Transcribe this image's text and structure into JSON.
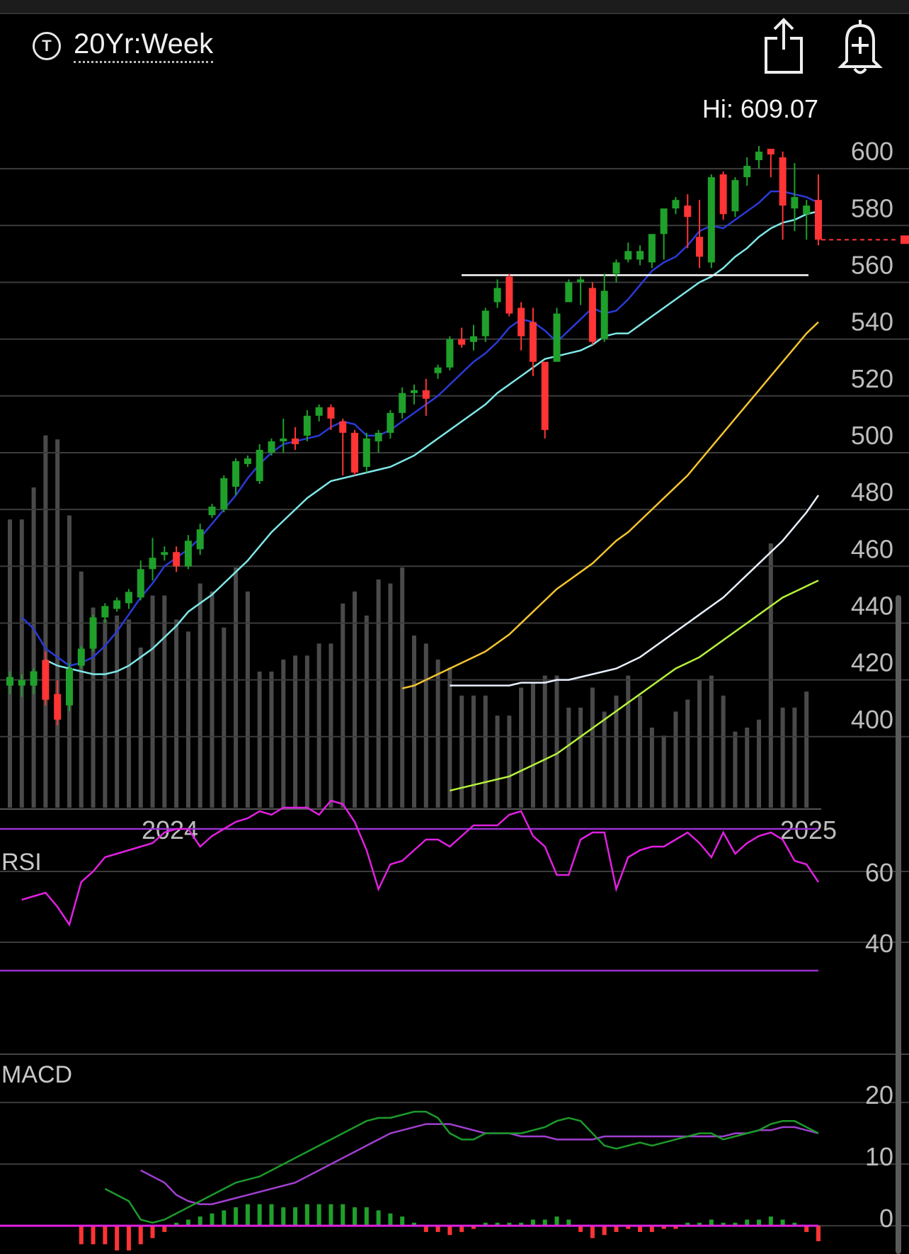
{
  "header": {
    "ticker_icon": "T",
    "range_label": "20Yr:Week",
    "hi_label": "Hi: 609.07",
    "share_icon": "share-icon",
    "alert_icon": "alert-add-icon"
  },
  "colors": {
    "up": "#1fa02a",
    "down": "#ff3434",
    "ema8": "#2a3ad8",
    "ema21": "#7fe8e8",
    "sma50": "#f4c430",
    "sma100": "#e8f0ff",
    "sma200": "#b6f23c",
    "rsi": "#e020e0",
    "rsi_band": "#9a30d0",
    "macd": "#1c9a2a",
    "signal": "#a040d0",
    "hist_zero": "#e020e0"
  },
  "chart_data": [
    {
      "type": "candlestick",
      "title": "20Yr:Week",
      "x_labels": [
        "2024",
        "2025"
      ],
      "y_ticks": [
        400,
        420,
        440,
        460,
        480,
        500,
        520,
        540,
        560,
        580,
        600
      ],
      "ylim": [
        377,
        612
      ],
      "high_value": 609.07,
      "last_price": 575,
      "resistance_level": 562.5,
      "grid": true,
      "candles": [
        {
          "o": 418,
          "h": 423,
          "l": 415,
          "c": 421
        },
        {
          "o": 418,
          "h": 422,
          "l": 414,
          "c": 420
        },
        {
          "o": 418,
          "h": 424,
          "l": 415,
          "c": 423
        },
        {
          "o": 427,
          "h": 430,
          "l": 411,
          "c": 413
        },
        {
          "o": 415,
          "h": 420,
          "l": 404,
          "c": 406
        },
        {
          "o": 411,
          "h": 426,
          "l": 409,
          "c": 424
        },
        {
          "o": 425,
          "h": 432,
          "l": 424,
          "c": 431
        },
        {
          "o": 431,
          "h": 443,
          "l": 430,
          "c": 442
        },
        {
          "o": 442,
          "h": 447,
          "l": 440,
          "c": 446
        },
        {
          "o": 445,
          "h": 449,
          "l": 444,
          "c": 448
        },
        {
          "o": 447,
          "h": 452,
          "l": 445,
          "c": 451
        },
        {
          "o": 449,
          "h": 462,
          "l": 448,
          "c": 459
        },
        {
          "o": 459,
          "h": 470,
          "l": 455,
          "c": 463
        },
        {
          "o": 464,
          "h": 467,
          "l": 462,
          "c": 465
        },
        {
          "o": 465,
          "h": 467,
          "l": 458,
          "c": 460
        },
        {
          "o": 460,
          "h": 471,
          "l": 459,
          "c": 469
        },
        {
          "o": 466,
          "h": 475,
          "l": 464,
          "c": 473
        },
        {
          "o": 478,
          "h": 482,
          "l": 477,
          "c": 481
        },
        {
          "o": 480,
          "h": 492,
          "l": 479,
          "c": 491
        },
        {
          "o": 488,
          "h": 498,
          "l": 485,
          "c": 497
        },
        {
          "o": 496,
          "h": 499,
          "l": 495,
          "c": 498
        },
        {
          "o": 490,
          "h": 503,
          "l": 489,
          "c": 501
        },
        {
          "o": 500,
          "h": 505,
          "l": 499,
          "c": 504
        },
        {
          "o": 504,
          "h": 512,
          "l": 500,
          "c": 505
        },
        {
          "o": 505,
          "h": 509,
          "l": 501,
          "c": 503
        },
        {
          "o": 506,
          "h": 515,
          "l": 504,
          "c": 513
        },
        {
          "o": 513,
          "h": 517,
          "l": 511,
          "c": 516
        },
        {
          "o": 516,
          "h": 517,
          "l": 508,
          "c": 512
        },
        {
          "o": 511,
          "h": 512,
          "l": 492,
          "c": 507
        },
        {
          "o": 507,
          "h": 508,
          "l": 492,
          "c": 493
        },
        {
          "o": 495,
          "h": 507,
          "l": 493,
          "c": 505
        },
        {
          "o": 504,
          "h": 508,
          "l": 500,
          "c": 507
        },
        {
          "o": 507,
          "h": 515,
          "l": 505,
          "c": 514
        },
        {
          "o": 514,
          "h": 523,
          "l": 512,
          "c": 521
        },
        {
          "o": 521,
          "h": 524,
          "l": 517,
          "c": 522
        },
        {
          "o": 522,
          "h": 526,
          "l": 513,
          "c": 519
        },
        {
          "o": 528,
          "h": 531,
          "l": 526,
          "c": 530
        },
        {
          "o": 530,
          "h": 541,
          "l": 529,
          "c": 540
        },
        {
          "o": 540,
          "h": 544,
          "l": 537,
          "c": 538
        },
        {
          "o": 539,
          "h": 545,
          "l": 536,
          "c": 541
        },
        {
          "o": 541,
          "h": 551,
          "l": 539,
          "c": 550
        },
        {
          "o": 553,
          "h": 561,
          "l": 551,
          "c": 558
        },
        {
          "o": 562,
          "h": 563,
          "l": 548,
          "c": 549
        },
        {
          "o": 551,
          "h": 553,
          "l": 536,
          "c": 541
        },
        {
          "o": 546,
          "h": 551,
          "l": 527,
          "c": 532
        },
        {
          "o": 532,
          "h": 531,
          "l": 505,
          "c": 508
        },
        {
          "o": 532,
          "h": 551,
          "l": 532,
          "c": 549
        },
        {
          "o": 553,
          "h": 561,
          "l": 553,
          "c": 560
        },
        {
          "o": 560,
          "h": 562,
          "l": 552,
          "c": 561
        },
        {
          "o": 558,
          "h": 560,
          "l": 538,
          "c": 539
        },
        {
          "o": 540,
          "h": 563,
          "l": 539,
          "c": 557
        },
        {
          "o": 563,
          "h": 568,
          "l": 560,
          "c": 567
        },
        {
          "o": 568,
          "h": 574,
          "l": 567,
          "c": 571
        },
        {
          "o": 568,
          "h": 573,
          "l": 566,
          "c": 571
        },
        {
          "o": 567,
          "h": 569,
          "l": 565,
          "c": 577
        },
        {
          "o": 577,
          "h": 578,
          "l": 568,
          "c": 586
        },
        {
          "o": 586,
          "h": 590,
          "l": 584,
          "c": 589
        },
        {
          "o": 587,
          "h": 591,
          "l": 572,
          "c": 583
        },
        {
          "o": 576,
          "h": 589,
          "l": 565,
          "c": 569
        },
        {
          "o": 567,
          "h": 598,
          "l": 565,
          "c": 597
        },
        {
          "o": 598,
          "h": 599,
          "l": 582,
          "c": 584
        },
        {
          "o": 585,
          "h": 597,
          "l": 583,
          "c": 596
        },
        {
          "o": 597,
          "h": 604,
          "l": 594,
          "c": 601
        },
        {
          "o": 603,
          "h": 608,
          "l": 600,
          "c": 606
        },
        {
          "o": 607,
          "h": 607,
          "l": 597,
          "c": 605
        },
        {
          "o": 604,
          "h": 606,
          "l": 575,
          "c": 587
        },
        {
          "o": 586,
          "h": 602,
          "l": 578,
          "c": 590
        },
        {
          "o": 584,
          "h": 589,
          "l": 575,
          "c": 587
        },
        {
          "o": 589,
          "h": 598,
          "l": 573,
          "c": 575
        }
      ],
      "ema8": [
        442,
        438,
        431,
        428,
        425,
        426,
        428,
        432,
        437,
        443,
        449,
        454,
        460,
        463,
        466,
        470,
        475,
        480,
        485,
        491,
        496,
        500,
        503,
        504,
        505,
        506,
        509,
        511,
        510,
        506,
        506,
        508,
        511,
        514,
        517,
        520,
        524,
        528,
        532,
        535,
        539,
        544,
        547,
        546,
        543,
        539,
        543,
        547,
        551,
        549,
        550,
        554,
        559,
        564,
        567,
        569,
        573,
        578,
        580,
        579,
        582,
        585,
        588,
        592,
        592,
        591,
        590,
        588
      ],
      "ema21": [
        427,
        425,
        424,
        423,
        422,
        422,
        423,
        425,
        428,
        431,
        435,
        439,
        444,
        447,
        450,
        454,
        458,
        462,
        467,
        472,
        476,
        480,
        484,
        487,
        490,
        491,
        492,
        493,
        494,
        495,
        497,
        499,
        502,
        505,
        508,
        511,
        514,
        517,
        521,
        524,
        527,
        530,
        533,
        534,
        535,
        536,
        538,
        541,
        542,
        542,
        545,
        548,
        551,
        554,
        557,
        560,
        562,
        565,
        569,
        572,
        576,
        579,
        581,
        582,
        584,
        585
      ],
      "sma50": [
        417,
        418,
        420,
        422,
        424,
        426,
        428,
        430,
        433,
        436,
        440,
        444,
        448,
        452,
        455,
        458,
        461,
        465,
        469,
        472,
        476,
        480,
        484,
        488,
        492,
        497,
        502,
        507,
        512,
        517,
        522,
        527,
        532,
        537,
        542,
        546
      ],
      "sma100": [
        418,
        418,
        418,
        418,
        418,
        418,
        419,
        419,
        419,
        420,
        420,
        421,
        422,
        423,
        424,
        426,
        428,
        431,
        434,
        437,
        440,
        443,
        446,
        449,
        453,
        457,
        461,
        465,
        469,
        474,
        479,
        485
      ],
      "sma200": [
        381,
        382,
        383,
        384,
        385,
        386,
        388,
        390,
        392,
        394,
        397,
        400,
        403,
        406,
        409,
        412,
        415,
        418,
        421,
        424,
        426,
        428,
        431,
        434,
        437,
        440,
        443,
        446,
        449,
        451,
        453,
        455
      ],
      "volume_relative": [
        0.72,
        0.72,
        0.8,
        0.93,
        0.92,
        0.73,
        0.59,
        0.5,
        0.47,
        0.48,
        0.47,
        0.4,
        0.53,
        0.53,
        0.47,
        0.44,
        0.56,
        0.54,
        0.45,
        0.6,
        0.54,
        0.34,
        0.34,
        0.37,
        0.38,
        0.38,
        0.41,
        0.41,
        0.51,
        0.54,
        0.48,
        0.57,
        0.56,
        0.6,
        0.43,
        0.41,
        0.37,
        0.35,
        0.28,
        0.28,
        0.28,
        0.23,
        0.23,
        0.3,
        0.31,
        0.33,
        0.33,
        0.25,
        0.25,
        0.3,
        0.24,
        0.28,
        0.33,
        0.28,
        0.2,
        0.18,
        0.24,
        0.27,
        0.32,
        0.33,
        0.28,
        0.19,
        0.2,
        0.22,
        0.66,
        0.25,
        0.25,
        0.29
      ]
    },
    {
      "type": "line",
      "title": "RSI",
      "y_ticks": [
        40,
        60
      ],
      "ylim": [
        25,
        79
      ],
      "bands": [
        30,
        70
      ],
      "values": [
        50,
        51,
        52,
        48,
        43,
        55,
        58,
        62,
        63,
        64,
        65,
        66,
        69,
        70,
        70,
        65,
        68,
        70,
        72,
        73,
        75,
        74,
        76,
        76,
        76,
        74,
        78,
        77,
        72,
        64,
        53,
        60,
        61,
        64,
        67,
        67,
        65,
        68,
        71,
        71,
        71,
        74,
        75,
        68,
        65,
        57,
        57,
        67,
        69,
        69,
        53,
        62,
        64,
        65,
        65,
        67,
        69,
        66,
        62,
        69,
        63,
        66,
        68,
        69,
        67,
        61,
        60,
        55
      ]
    },
    {
      "type": "line",
      "title": "MACD",
      "y_ticks": [
        0,
        10,
        20
      ],
      "ylim": [
        -4,
        23
      ],
      "macd": [
        6,
        5,
        4,
        1,
        0.5,
        1,
        2,
        3,
        4,
        5,
        6,
        7,
        7.5,
        8,
        9,
        10,
        11,
        12,
        13,
        14,
        15,
        16,
        17,
        17.5,
        17.5,
        18,
        18.5,
        18.5,
        17.5,
        15,
        14,
        14,
        15,
        15,
        15,
        15,
        15.5,
        16,
        17,
        17.5,
        17,
        15,
        13,
        12.5,
        13,
        13.5,
        13,
        13.5,
        14,
        14.5,
        15,
        15,
        14,
        14.5,
        15,
        15.5,
        16.5,
        17,
        17,
        16,
        15
      ],
      "signal": [
        9,
        8,
        7,
        5,
        4,
        3.5,
        3.5,
        4,
        4.5,
        5,
        5.5,
        6,
        6.5,
        7,
        8,
        9,
        10,
        11,
        12,
        13,
        14,
        15,
        15.5,
        16,
        16.5,
        16.5,
        16.5,
        16,
        15.5,
        15,
        15,
        15,
        14.5,
        14.5,
        14.5,
        14,
        14,
        14,
        14,
        14.5,
        14.5,
        14.5,
        14.5,
        14.5,
        14.5,
        14.5,
        14.5,
        14.5,
        14.5,
        14.5,
        15,
        15,
        15.5,
        15.5,
        16,
        16,
        15.5,
        15
      ],
      "histogram": [
        -3,
        -3,
        -3,
        -4,
        -4,
        -3,
        -2,
        -1,
        0.5,
        1,
        1.5,
        2,
        2.5,
        3,
        3.5,
        3.5,
        3.5,
        3,
        3,
        3.5,
        3.5,
        3.5,
        3.5,
        3,
        3,
        2.5,
        2,
        1.5,
        0.5,
        -1,
        -1,
        -1.5,
        -1,
        -0.5,
        0.5,
        0.5,
        0.5,
        0.5,
        1,
        1,
        1.5,
        1,
        -1,
        -2,
        -1.5,
        -1,
        -0.5,
        -1,
        -1,
        -0.5,
        -0.5,
        0.5,
        0.5,
        1,
        0.5,
        0.5,
        1,
        1,
        1.5,
        1,
        0.5,
        -1,
        -2.5
      ]
    }
  ]
}
